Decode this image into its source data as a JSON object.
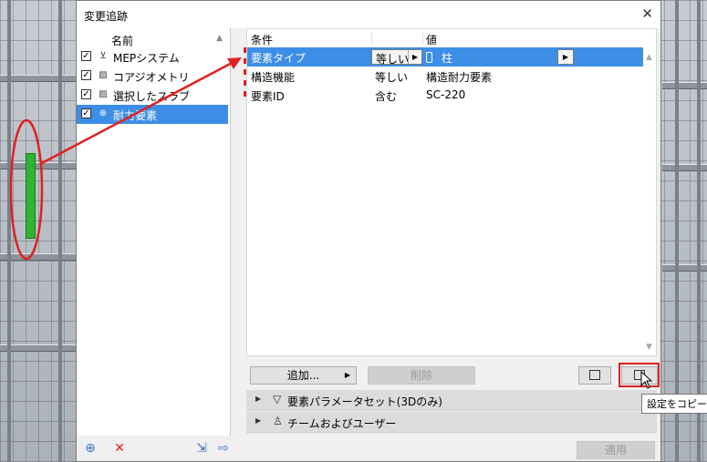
{
  "dialog": {
    "title": "変更追跡",
    "close_glyph": "✕"
  },
  "left_list": {
    "header": "名前",
    "sort_glyph": "▲",
    "items": [
      {
        "label": "MEPシステム",
        "icon": "mep-icon",
        "icon_glyph": "⊻",
        "checked": true
      },
      {
        "label": "コアジオメトリ",
        "icon": "hatch-icon",
        "icon_glyph": "▨",
        "checked": true
      },
      {
        "label": "選択したスラブ",
        "icon": "hatch-icon",
        "icon_glyph": "▨",
        "checked": true
      },
      {
        "label": "耐力要素",
        "icon": "search-element-icon",
        "icon_glyph": "⊕",
        "checked": true,
        "selected": true
      }
    ],
    "check_glyph": "✓",
    "footer": {
      "add_glyph": "⊕",
      "delete_glyph": "✕",
      "import_glyph": "⇲",
      "export_glyph": "⇨"
    }
  },
  "criteria": {
    "headers": {
      "condition": "条件",
      "value": "値"
    },
    "rows": [
      {
        "condition": "要素タイプ",
        "operator": "等しい",
        "value": "柱",
        "selected": true
      },
      {
        "condition": "構造機能",
        "operator": "等しい",
        "value": "構造耐力要素"
      },
      {
        "condition": "要素ID",
        "operator": "含む",
        "value": "SC-220"
      }
    ],
    "dropdown_arrow": "▶",
    "scroll_up": "▲",
    "scroll_down": "▼"
  },
  "buttons": {
    "add": "追加...",
    "add_arrow": "▶",
    "delete": "削除",
    "apply": "適用"
  },
  "sections": [
    {
      "label": "要素パラメータセット(3Dのみ)",
      "icon": "filter-icon",
      "glyph": "▽"
    },
    {
      "label": "チームおよびユーザー",
      "icon": "user-icon",
      "glyph": "♙"
    }
  ],
  "section_triangle": "▶",
  "tooltip": "設定をコピー",
  "colors": {
    "selection": "#3d8ee6",
    "annotation": "#e02020",
    "highlight_green": "#2fb52f"
  }
}
